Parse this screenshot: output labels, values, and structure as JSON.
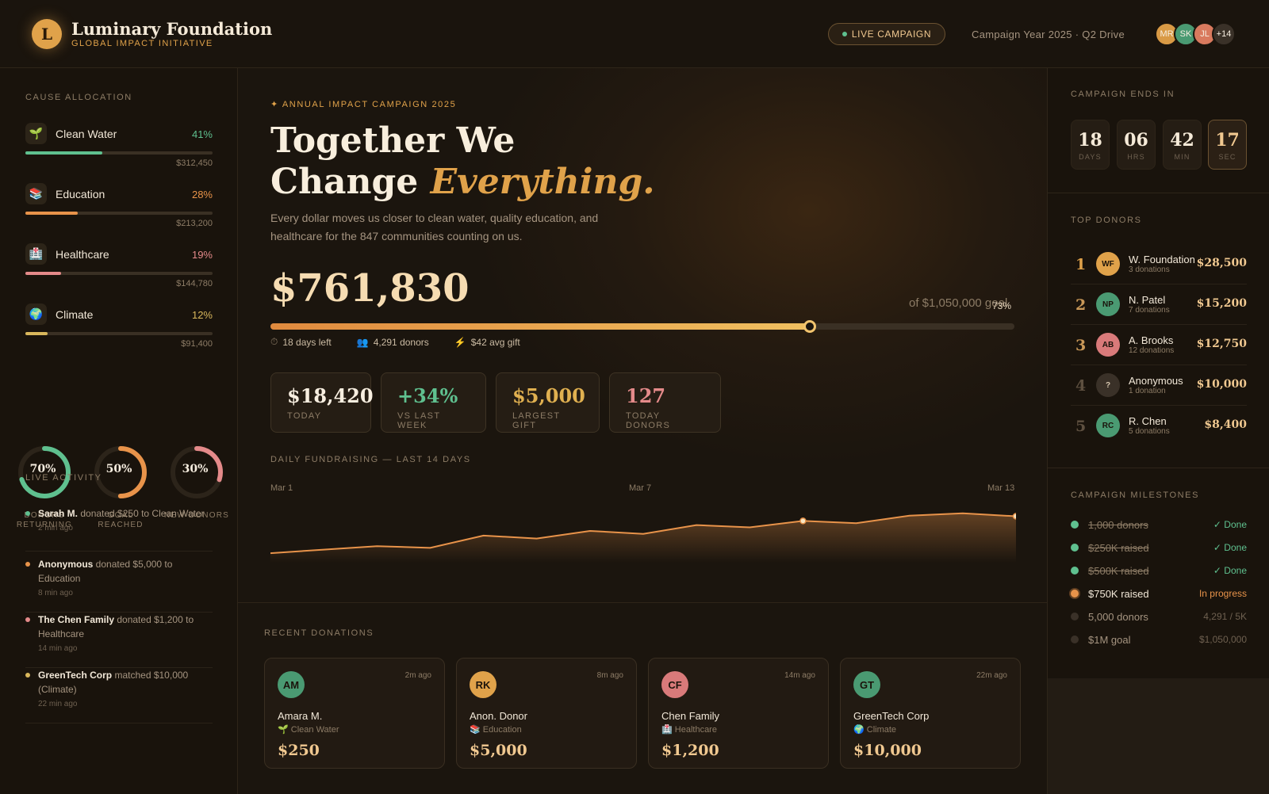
{
  "header": {
    "logo_letter": "L",
    "brand_title": "Luminary Foundation",
    "brand_subtitle": "GLOBAL IMPACT INITIATIVE",
    "live_label": "LIVE CAMPAIGN",
    "campaign_year": "Campaign Year 2025 · Q2 Drive",
    "avatars": [
      {
        "initials": "MR",
        "color": "#d99a45"
      },
      {
        "initials": "SK",
        "color": "#4a9a72"
      },
      {
        "initials": "JL",
        "color": "#d97a5e"
      },
      {
        "initials": "+14",
        "color": "#3a3128"
      }
    ]
  },
  "left": {
    "allocation_title": "CAUSE ALLOCATION",
    "causes": [
      {
        "icon": "🌱",
        "icon_name": "seedling-icon",
        "name": "Clean Water",
        "pct": "41%",
        "pct_value": 0.41,
        "amount": "$312,450",
        "color": "#5fc08f"
      },
      {
        "icon": "📚",
        "icon_name": "books-icon",
        "name": "Education",
        "pct": "28%",
        "pct_value": 0.28,
        "amount": "$213,200",
        "color": "#e8934a"
      },
      {
        "icon": "🏥",
        "icon_name": "hospital-icon",
        "name": "Healthcare",
        "pct": "19%",
        "pct_value": 0.19,
        "amount": "$144,780",
        "color": "#e48a8a"
      },
      {
        "icon": "🌍",
        "icon_name": "globe-icon",
        "name": "Climate",
        "pct": "12%",
        "pct_value": 0.12,
        "amount": "$91,400",
        "color": "#d9b75c"
      }
    ],
    "rings": [
      {
        "value": "70%",
        "fraction": 0.7,
        "label": "DONORS RETURNING",
        "color": "#5fc08f"
      },
      {
        "value": "50%",
        "fraction": 0.5,
        "label": "GOAL REACHED",
        "color": "#e8934a"
      },
      {
        "value": "30%",
        "fraction": 0.3,
        "label": "NEW DONORS",
        "color": "#e48a8a"
      }
    ],
    "activity_title": "LIVE ACTIVITY",
    "activity": [
      {
        "who": "Sarah M.",
        "text": " donated $250 to Clean Water",
        "time": "2 min ago",
        "color": "#5fc08f"
      },
      {
        "who": "Anonymous",
        "text": " donated $5,000 to Education",
        "time": "8 min ago",
        "color": "#e8934a"
      },
      {
        "who": "The Chen Family",
        "text": " donated $1,200 to Healthcare",
        "time": "14 min ago",
        "color": "#e48a8a"
      },
      {
        "who": "GreenTech Corp",
        "text": " matched $10,000 (Climate)",
        "time": "22 min ago",
        "color": "#d9b75c"
      }
    ]
  },
  "hero": {
    "eyebrow": "✦ ANNUAL IMPACT CAMPAIGN 2025",
    "headline_line1": "Together We",
    "headline_line2_plain": "Change ",
    "headline_line2_accent": "Everything.",
    "tagline": "Every dollar moves us closer to clean water, quality education, and healthcare for the 847 communities counting on us.",
    "raised": "$761,830",
    "goal_text": "of $1,050,000 goal",
    "progress_pct": "73%",
    "progress_fraction": 0.725,
    "meta": [
      {
        "icon": "⏱",
        "icon_name": "clock-icon",
        "text": "18 days left"
      },
      {
        "icon": "👥",
        "icon_name": "people-icon",
        "text": "4,291 donors"
      },
      {
        "icon": "⚡",
        "icon_name": "lightning-icon",
        "text": "$42 avg gift"
      }
    ]
  },
  "kpis": [
    {
      "value": "$18,420",
      "label": "TODAY",
      "color": "#f7eee0"
    },
    {
      "value": "+34%",
      "label": "VS LAST WEEK",
      "color": "#5fc08f"
    },
    {
      "value": "$5,000",
      "label": "LARGEST GIFT",
      "color": "#e0b050"
    },
    {
      "value": "127",
      "label": "TODAY DONORS",
      "color": "#e48a8a"
    }
  ],
  "chart_data": {
    "type": "area",
    "title": "DAILY FUNDRAISING — LAST 14 DAYS",
    "x_ticks": [
      "Mar 1",
      "Mar 7",
      "Mar 13"
    ],
    "x": [
      1,
      2,
      3,
      4,
      5,
      6,
      7,
      8,
      9,
      10,
      11,
      12,
      13,
      14
    ],
    "values": [
      8,
      14,
      20,
      17,
      38,
      33,
      46,
      41,
      56,
      52,
      63,
      59,
      72,
      76,
      71
    ],
    "highlight_points": [
      10,
      14
    ],
    "color": "#e8934a",
    "ylim": [
      0,
      100
    ],
    "grid": false
  },
  "recent": {
    "title": "RECENT DONATIONS",
    "cards": [
      {
        "initials": "AM",
        "time": "2m ago",
        "name": "Amara M.",
        "icon": "🌱",
        "cause": "Clean Water",
        "amount": "$250",
        "color": "#4a9a72"
      },
      {
        "initials": "RK",
        "time": "8m ago",
        "name": "Anon. Donor",
        "icon": "📚",
        "cause": "Education",
        "amount": "$5,000",
        "color": "#e0a24a"
      },
      {
        "initials": "CF",
        "time": "14m ago",
        "name": "Chen Family",
        "icon": "🏥",
        "cause": "Healthcare",
        "amount": "$1,200",
        "color": "#d97a7a"
      },
      {
        "initials": "GT",
        "time": "22m ago",
        "name": "GreenTech Corp",
        "icon": "🌍",
        "cause": "Climate",
        "amount": "$10,000",
        "color": "#4a9a72"
      }
    ]
  },
  "right": {
    "countdown_title": "CAMPAIGN ENDS IN",
    "countdown": [
      {
        "value": "18",
        "label": "DAYS"
      },
      {
        "value": "06",
        "label": "HRS"
      },
      {
        "value": "42",
        "label": "MIN"
      },
      {
        "value": "17",
        "label": "SEC"
      }
    ],
    "donors_title": "TOP DONORS",
    "donors": [
      {
        "rank": "1",
        "initials": "WF",
        "name": "W. Foundation",
        "count": "3 donations",
        "amount": "$28,500",
        "color": "#e0a24a",
        "rank_color": "#e0a24a"
      },
      {
        "rank": "2",
        "initials": "NP",
        "name": "N. Patel",
        "count": "7 donations",
        "amount": "$15,200",
        "color": "#4a9a72",
        "rank_color": "#c99858"
      },
      {
        "rank": "3",
        "initials": "AB",
        "name": "A. Brooks",
        "count": "12 donations",
        "amount": "$12,750",
        "color": "#d97a7a",
        "rank_color": "#c99858"
      },
      {
        "rank": "4",
        "initials": "?",
        "name": "Anonymous",
        "count": "1 donation",
        "amount": "$10,000",
        "color": "#3a3128",
        "rank_color": "#5e5040"
      },
      {
        "rank": "5",
        "initials": "RC",
        "name": "R. Chen",
        "count": "5 donations",
        "amount": "$8,400",
        "color": "#4a9a72",
        "rank_color": "#5e5040"
      }
    ],
    "milestones_title": "CAMPAIGN MILESTONES",
    "milestones": [
      {
        "name": "1,000 donors",
        "status": "✓ Done",
        "state": "done"
      },
      {
        "name": "$250K raised",
        "status": "✓ Done",
        "state": "done"
      },
      {
        "name": "$500K raised",
        "status": "✓ Done",
        "state": "done"
      },
      {
        "name": "$750K raised",
        "status": "In progress",
        "state": "progress"
      },
      {
        "name": "5,000 donors",
        "status": "4,291 / 5K",
        "state": "pending"
      },
      {
        "name": "$1M goal",
        "status": "$1,050,000",
        "state": "pending"
      }
    ]
  }
}
